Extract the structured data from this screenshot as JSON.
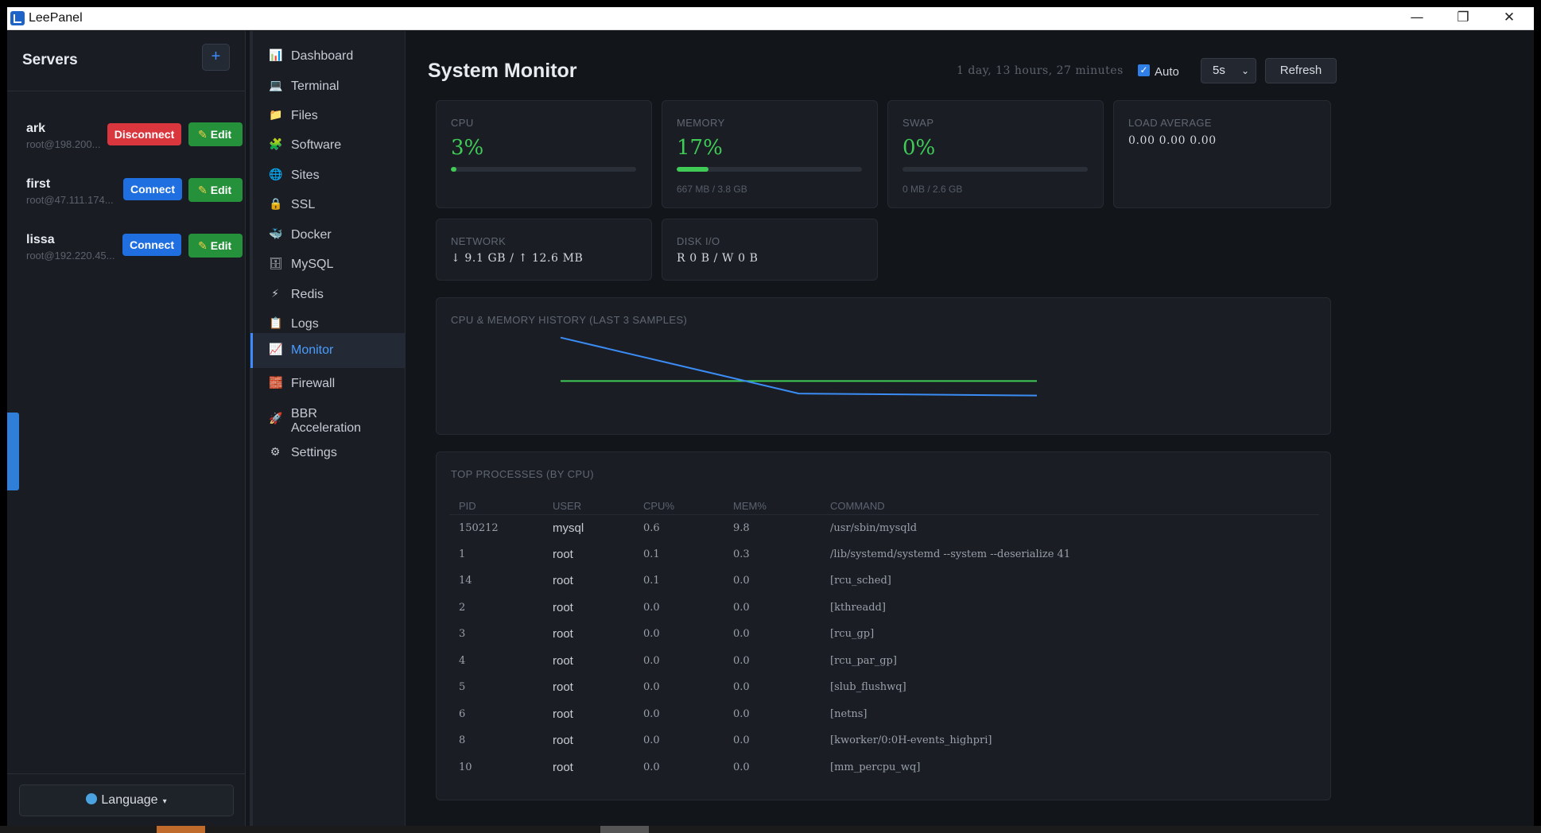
{
  "window": {
    "title": "LeePanel",
    "minimize_icon": "—",
    "restore_icon": "❐",
    "close_icon": "✕"
  },
  "servers_panel": {
    "title": "Servers",
    "add_label": "+",
    "servers": [
      {
        "name": "ark",
        "address": "root@198.200...",
        "action": "Disconnect",
        "edit": "Edit"
      },
      {
        "name": "first",
        "address": "root@47.111.174...",
        "action": "Connect",
        "edit": "Edit"
      },
      {
        "name": "lissa",
        "address": "root@192.220.45...",
        "action": "Connect",
        "edit": "Edit"
      }
    ],
    "language_label": "Language",
    "language_caret": "▾"
  },
  "nav": {
    "items": [
      {
        "label": "Dashboard",
        "icon": "📊"
      },
      {
        "label": "Terminal",
        "icon": "💻"
      },
      {
        "label": "Files",
        "icon": "📁"
      },
      {
        "label": "Software",
        "icon": "🧩"
      },
      {
        "label": "Sites",
        "icon": "🌐"
      },
      {
        "label": "SSL",
        "icon": "🔒"
      },
      {
        "label": "Docker",
        "icon": "🐳"
      },
      {
        "label": "MySQL",
        "icon": "🗄"
      },
      {
        "label": "Redis",
        "icon": "⚡"
      },
      {
        "label": "Logs",
        "icon": "📋"
      },
      {
        "label": "Monitor",
        "icon": "📈"
      },
      {
        "label": "Firewall",
        "icon": "🧱"
      },
      {
        "label": "BBR Acceleration",
        "icon": "🚀"
      },
      {
        "label": "Settings",
        "icon": "⚙"
      }
    ],
    "active": "Monitor"
  },
  "header": {
    "title": "System Monitor",
    "uptime": "1 day, 13 hours, 27 minutes",
    "auto_label": "Auto",
    "auto_checked": true,
    "interval_value": "5s",
    "refresh_label": "Refresh"
  },
  "stats": {
    "cpu": {
      "label": "CPU",
      "value": "3%",
      "percent": 3
    },
    "memory": {
      "label": "MEMORY",
      "value": "17%",
      "percent": 17,
      "detail": "667 MB / 3.8 GB"
    },
    "swap": {
      "label": "SWAP",
      "value": "0%",
      "percent": 0,
      "detail": "0 MB / 2.6 GB"
    },
    "load": {
      "label": "LOAD AVERAGE",
      "value": "0.00 0.00 0.00"
    },
    "network": {
      "label": "NETWORK",
      "value": "↓ 9.1 GB / ↑ 12.6 MB"
    },
    "disk": {
      "label": "DISK I/O",
      "value": "R 0 B / W 0 B"
    }
  },
  "history": {
    "title": "CPU & MEMORY HISTORY (LAST 3 SAMPLES)",
    "cpu": [
      62,
      4,
      2
    ],
    "memory": [
      17,
      17,
      17
    ],
    "ymax": 70,
    "colors": {
      "cpu": "#3b8cf5",
      "memory": "#3fcb56"
    }
  },
  "processes": {
    "title": "TOP PROCESSES (BY CPU)",
    "columns": [
      "PID",
      "USER",
      "CPU%",
      "MEM%",
      "COMMAND"
    ],
    "rows": [
      [
        "150212",
        "mysql",
        "0.6",
        "9.8",
        "/usr/sbin/mysqld"
      ],
      [
        "1",
        "root",
        "0.1",
        "0.3",
        "/lib/systemd/systemd --system --deserialize 41"
      ],
      [
        "14",
        "root",
        "0.1",
        "0.0",
        "[rcu_sched]"
      ],
      [
        "2",
        "root",
        "0.0",
        "0.0",
        "[kthreadd]"
      ],
      [
        "3",
        "root",
        "0.0",
        "0.0",
        "[rcu_gp]"
      ],
      [
        "4",
        "root",
        "0.0",
        "0.0",
        "[rcu_par_gp]"
      ],
      [
        "5",
        "root",
        "0.0",
        "0.0",
        "[slub_flushwq]"
      ],
      [
        "6",
        "root",
        "0.0",
        "0.0",
        "[netns]"
      ],
      [
        "8",
        "root",
        "0.0",
        "0.0",
        "[kworker/0:0H-events_highpri]"
      ],
      [
        "10",
        "root",
        "0.0",
        "0.0",
        "[mm_percpu_wq]"
      ]
    ]
  }
}
